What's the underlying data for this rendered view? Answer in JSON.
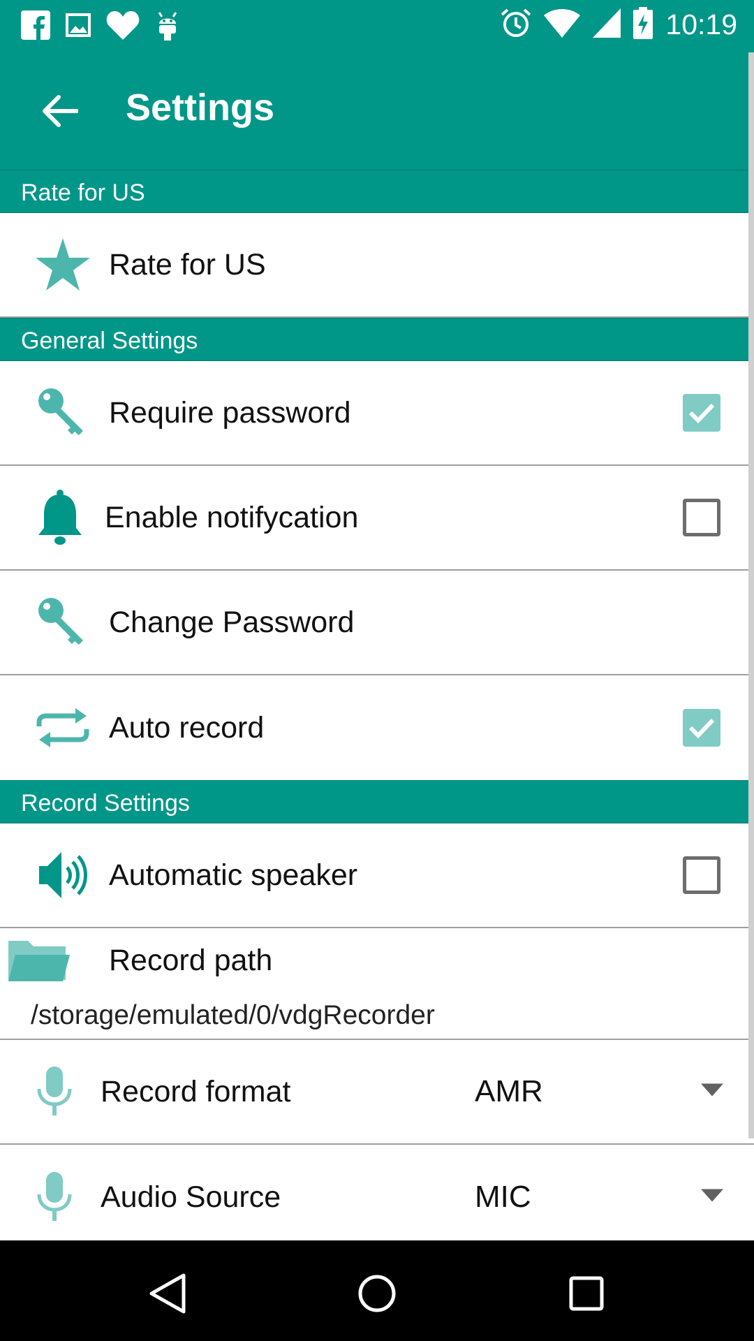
{
  "status_bar": {
    "time": "10:19",
    "left_icons": [
      "facebook-icon",
      "gallery-icon",
      "heart-icon",
      "android-icon"
    ],
    "right_icons": [
      "alarm-icon",
      "wifi-icon",
      "cell-signal-icon",
      "battery-charging-icon"
    ]
  },
  "app_bar": {
    "title": "Settings",
    "back_icon": "back-arrow-icon"
  },
  "sections": {
    "rate": "Rate for US",
    "general": "General Settings",
    "record": "Record Settings"
  },
  "items": {
    "rate_for_us": {
      "label": "Rate for US",
      "icon": "star-icon"
    },
    "require_password": {
      "label": "Require password",
      "icon": "key-icon",
      "checked": true
    },
    "enable_notification": {
      "label": "Enable notifycation",
      "icon": "bell-icon",
      "checked": false
    },
    "change_password": {
      "label": "Change Password",
      "icon": "key-icon"
    },
    "auto_record": {
      "label": "Auto record",
      "icon": "repeat-icon",
      "checked": true
    },
    "automatic_speaker": {
      "label": "Automatic speaker",
      "icon": "speaker-icon",
      "checked": false
    },
    "record_path": {
      "label": "Record path",
      "value": "/storage/emulated/0/vdgRecorder",
      "icon": "folder-icon"
    },
    "record_format": {
      "label": "Record format",
      "value": "AMR",
      "icon": "mic-icon"
    },
    "audio_source": {
      "label": "Audio Source",
      "value": "MIC",
      "icon": "mic-icon"
    }
  },
  "nav_bar": {
    "buttons": [
      "back-triangle-icon",
      "home-circle-icon",
      "recents-square-icon"
    ]
  },
  "colors": {
    "primary": "#009688",
    "icon_teal": "#4db6ac",
    "checkbox_checked": "#80cbc4"
  }
}
